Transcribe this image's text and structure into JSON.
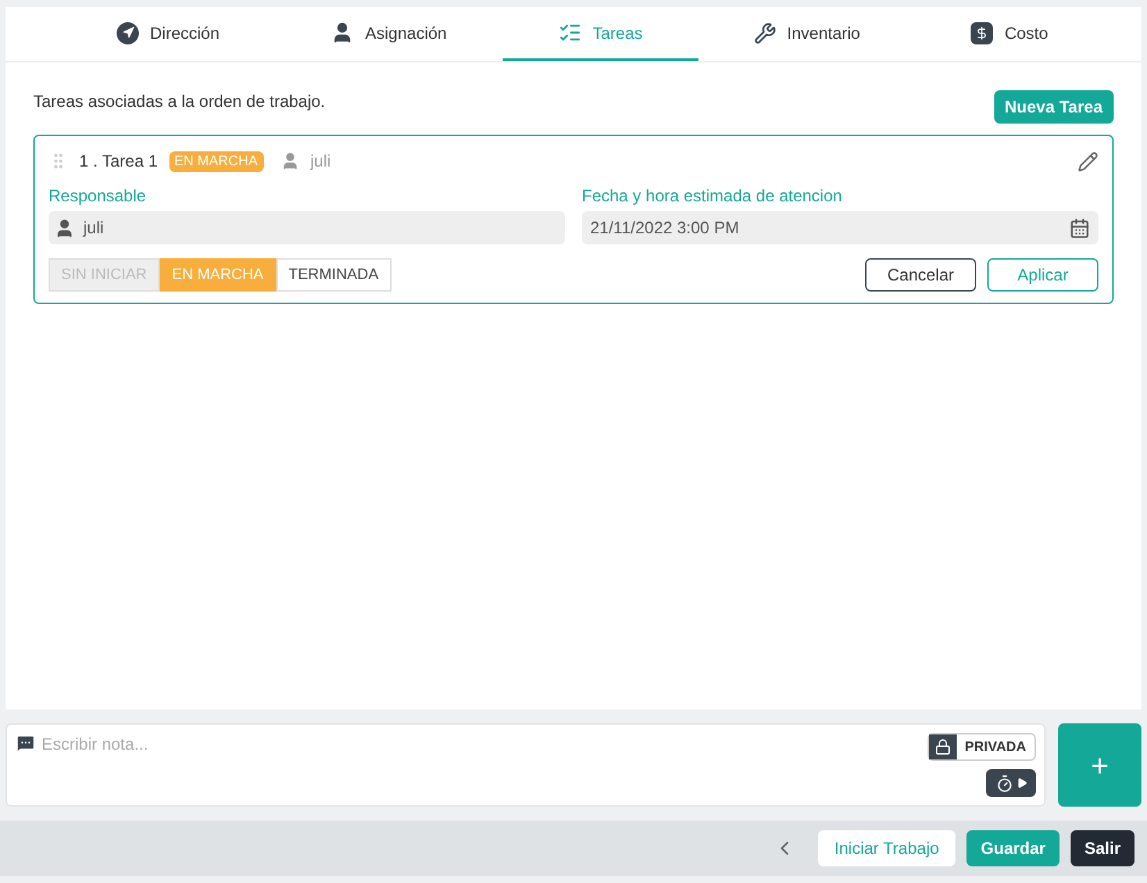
{
  "tabs": [
    {
      "label": "Dirección",
      "kind": "navigation",
      "selected": false
    },
    {
      "label": "Asignación",
      "kind": "person",
      "selected": false
    },
    {
      "label": "Tareas",
      "kind": "list",
      "selected": true
    },
    {
      "label": "Inventario",
      "kind": "tools",
      "selected": false
    },
    {
      "label": "Costo",
      "kind": "money",
      "selected": false
    }
  ],
  "intro": "Tareas asociadas a la orden de trabajo.",
  "new_task_button": "Nueva Tarea",
  "task": {
    "number": "1 .",
    "title": "Tarea 1",
    "badge": "EN MARCHA",
    "assignee": "juli",
    "responsible": {
      "label": "Responsable",
      "value": "juli"
    },
    "date": {
      "label": "Fecha y hora estimada de atencion",
      "value": "21/11/2022 3:00 PM"
    },
    "statuses": [
      {
        "label": "SIN INICIAR",
        "selected": false,
        "disabled": true
      },
      {
        "label": "EN MARCHA",
        "selected": true,
        "disabled": false
      },
      {
        "label": "TERMINADA",
        "selected": false,
        "disabled": false
      }
    ],
    "buttons": {
      "cancel": "Cancelar",
      "apply": "Aplicar"
    }
  },
  "note": {
    "placeholder": "Escribir nota...",
    "privacy": "PRIVADA",
    "add": "+"
  },
  "footer": {
    "start": "Iniciar Trabajo",
    "save": "Guardar",
    "exit": "Salir"
  }
}
